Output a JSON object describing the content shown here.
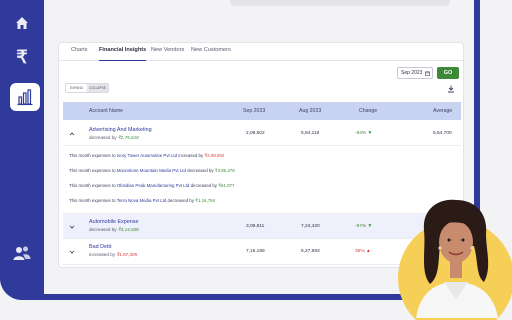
{
  "tabs": [
    {
      "label": "Charts"
    },
    {
      "label": "Financial Insights"
    },
    {
      "label": "New Vendors"
    },
    {
      "label": "New Customers"
    }
  ],
  "filter": {
    "month": "Sep 2023",
    "go": "GO"
  },
  "toggle": {
    "expand": "EXPAND",
    "collapse": "COLLAPSE"
  },
  "table": {
    "headers": {
      "account": "Account Name",
      "sep": "Sep 2023",
      "aug": "Aug 2023",
      "change": "Change",
      "avg": "Average"
    },
    "rows": [
      {
        "account": "Advertising And Marketing",
        "sub": "decreased by",
        "sub_val": "₹2,75,618",
        "sep": "2,08,502",
        "aug": "5,84,118",
        "change": "-64%",
        "avg": "5,54,700"
      },
      {
        "account": "Automobile Expense",
        "sub": "decreased by",
        "sub_val": "₹4,14,608",
        "sep": "3,09,811",
        "aug": "7,24,420",
        "change": "-57%",
        "avg": ""
      },
      {
        "account": "Bad Debt",
        "sub": "increased by",
        "sub_val": "₹1,87,305",
        "sep": "7,15,189",
        "aug": "5,27,883",
        "change": "35%",
        "avg": ""
      }
    ],
    "details": [
      {
        "pre": "This month expenses to",
        "vendor": "Ivory Tower Automotive Pvt Ltd",
        "mid": "increased by",
        "amt": "₹2,08,502"
      },
      {
        "pre": "This month expenses to",
        "vendor": "Moonstone Mountain Media Pvt Ltd",
        "mid": "decreased by",
        "amt": "₹3,86,278"
      },
      {
        "pre": "This month expenses to",
        "vendor": "Obsidian Peak Manufacturing Pvt Ltd",
        "mid": "decreased by",
        "amt": "₹61,077"
      },
      {
        "pre": "This month expenses to",
        "vendor": "Terra Nova Media Pvt Ltd",
        "mid": "decreased by",
        "amt": "₹1,16,764"
      }
    ]
  },
  "colors": {
    "brand": "#303a9b",
    "go": "#3e8a3a",
    "decrease": "#3e8a3a",
    "increase": "#d93a3a"
  },
  "icons": [
    "home-icon",
    "rupee-icon",
    "bar-chart-icon",
    "users-icon",
    "calendar-icon",
    "download-icon",
    "chevron-up-icon",
    "chevron-down-icon"
  ]
}
